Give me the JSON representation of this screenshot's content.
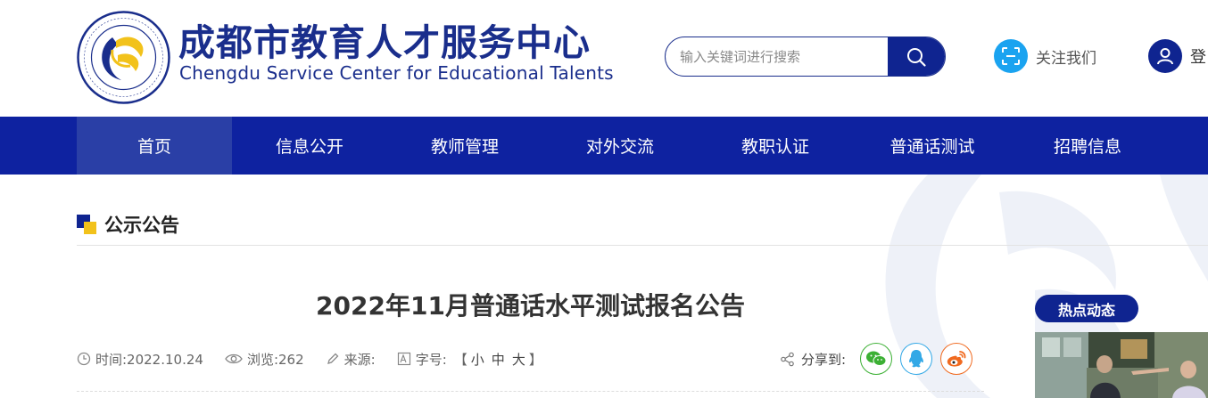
{
  "header": {
    "logo_cn": "成都市教育人才服务中心",
    "logo_en": "Chengdu Service Center for Educational Talents",
    "search_placeholder": "输入关键词进行搜索",
    "follow_label": "关注我们",
    "login_label": "登"
  },
  "nav": {
    "items": [
      {
        "label": "首页",
        "active": true
      },
      {
        "label": "信息公开"
      },
      {
        "label": "教师管理"
      },
      {
        "label": "对外交流"
      },
      {
        "label": "教职认证"
      },
      {
        "label": "普通话测试"
      },
      {
        "label": "招聘信息"
      }
    ]
  },
  "section": {
    "title": "公示公告"
  },
  "article": {
    "title": "2022年11月普通话水平测试报名公告",
    "time_label": "时间:2022.10.24",
    "views_label": "浏览:262",
    "source_label": "来源:",
    "fontsize_label": "字号:",
    "fontsize_open": "【",
    "fontsize_small": "小",
    "fontsize_medium": "中",
    "fontsize_large": "大",
    "fontsize_close": "】",
    "share_label": "分享到:"
  },
  "sidebar": {
    "hot_title": "热点动态"
  },
  "colors": {
    "brand_blue": "#0f2490",
    "nav_blue": "#0e22a0",
    "accent_yellow": "#f2c21b",
    "wechat_green": "#3cb034",
    "qq_blue": "#32a8e6",
    "weibo_orange": "#f06a20"
  }
}
